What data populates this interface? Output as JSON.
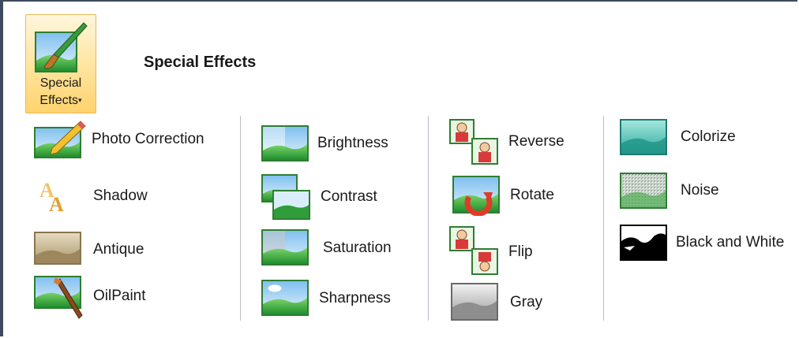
{
  "ribbon": {
    "button_label_line1": "Special",
    "button_label_line2": "Effects",
    "button_caret": "▾",
    "button_icon": "paintbrush-picture-icon",
    "title": "Special Effects"
  },
  "columns": [
    {
      "items": [
        {
          "label": "Photo Correction",
          "icon": "photo-correction-icon"
        },
        {
          "label": "Shadow",
          "icon": "shadow-text-icon"
        },
        {
          "label": "Antique",
          "icon": "antique-photo-icon"
        },
        {
          "label": "OilPaint",
          "icon": "oilpaint-brush-icon"
        }
      ]
    },
    {
      "items": [
        {
          "label": "Brightness",
          "icon": "brightness-icon"
        },
        {
          "label": "Contrast",
          "icon": "contrast-icon"
        },
        {
          "label": "Saturation",
          "icon": "saturation-icon"
        },
        {
          "label": "Sharpness",
          "icon": "sharpness-icon"
        }
      ]
    },
    {
      "items": [
        {
          "label": "Reverse",
          "icon": "reverse-icon"
        },
        {
          "label": "Rotate",
          "icon": "rotate-icon"
        },
        {
          "label": "Flip",
          "icon": "flip-icon"
        },
        {
          "label": "Gray",
          "icon": "gray-icon"
        }
      ]
    },
    {
      "items": [
        {
          "label": "Colorize",
          "icon": "colorize-icon"
        },
        {
          "label": "Noise",
          "icon": "noise-icon"
        },
        {
          "label": "Black and White",
          "icon": "black-and-white-icon"
        }
      ]
    }
  ],
  "colors": {
    "frame": "#3c4a5e",
    "button_active_top": "#fff6dc",
    "button_active_bottom": "#ffd36e",
    "separator": "#b8bcc4",
    "sky": "#bfe0f8",
    "grass": "#3aa845"
  }
}
